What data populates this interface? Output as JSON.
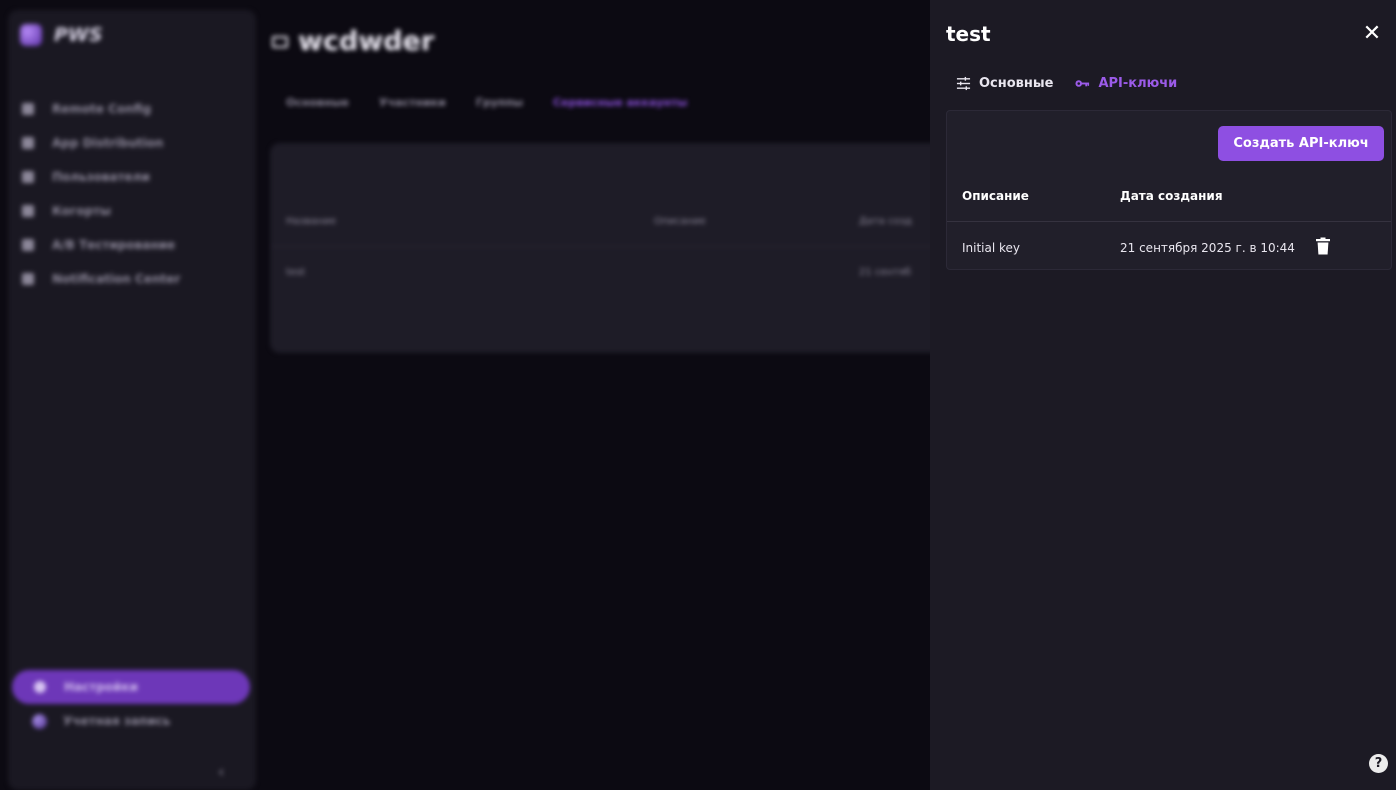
{
  "background": {
    "logo": "PWS",
    "nav": [
      "Remote Config",
      "App Distribution",
      "Пользователи",
      "Когорты",
      "A/B Тестирование",
      "Notification Center"
    ],
    "nav_active": "Настройки",
    "nav_account": "Учетная запись",
    "collapse_glyph": "‹",
    "project_title": "wcdwder",
    "tabs": [
      "Основные",
      "Участники",
      "Группы",
      "Сервисные аккаунты"
    ],
    "table": {
      "headers": [
        "Название",
        "Описание",
        "Дата созд"
      ],
      "row": [
        "test",
        "",
        "21 сентяб"
      ]
    }
  },
  "drawer": {
    "title": "test",
    "close_glyph": "✕",
    "tabs": {
      "general": "Основные",
      "api_keys": "API-ключи"
    },
    "create_button": "Создать API-ключ",
    "table": {
      "headers": {
        "description": "Описание",
        "created": "Дата создания"
      },
      "rows": [
        {
          "description": "Initial key",
          "created": "21 сентября 2025 г. в 10:44"
        }
      ]
    },
    "help_glyph": "?"
  },
  "colors": {
    "accent": "#8e4fe2",
    "drawer_bg": "#1c1a24",
    "card_bg": "#211f2a"
  }
}
